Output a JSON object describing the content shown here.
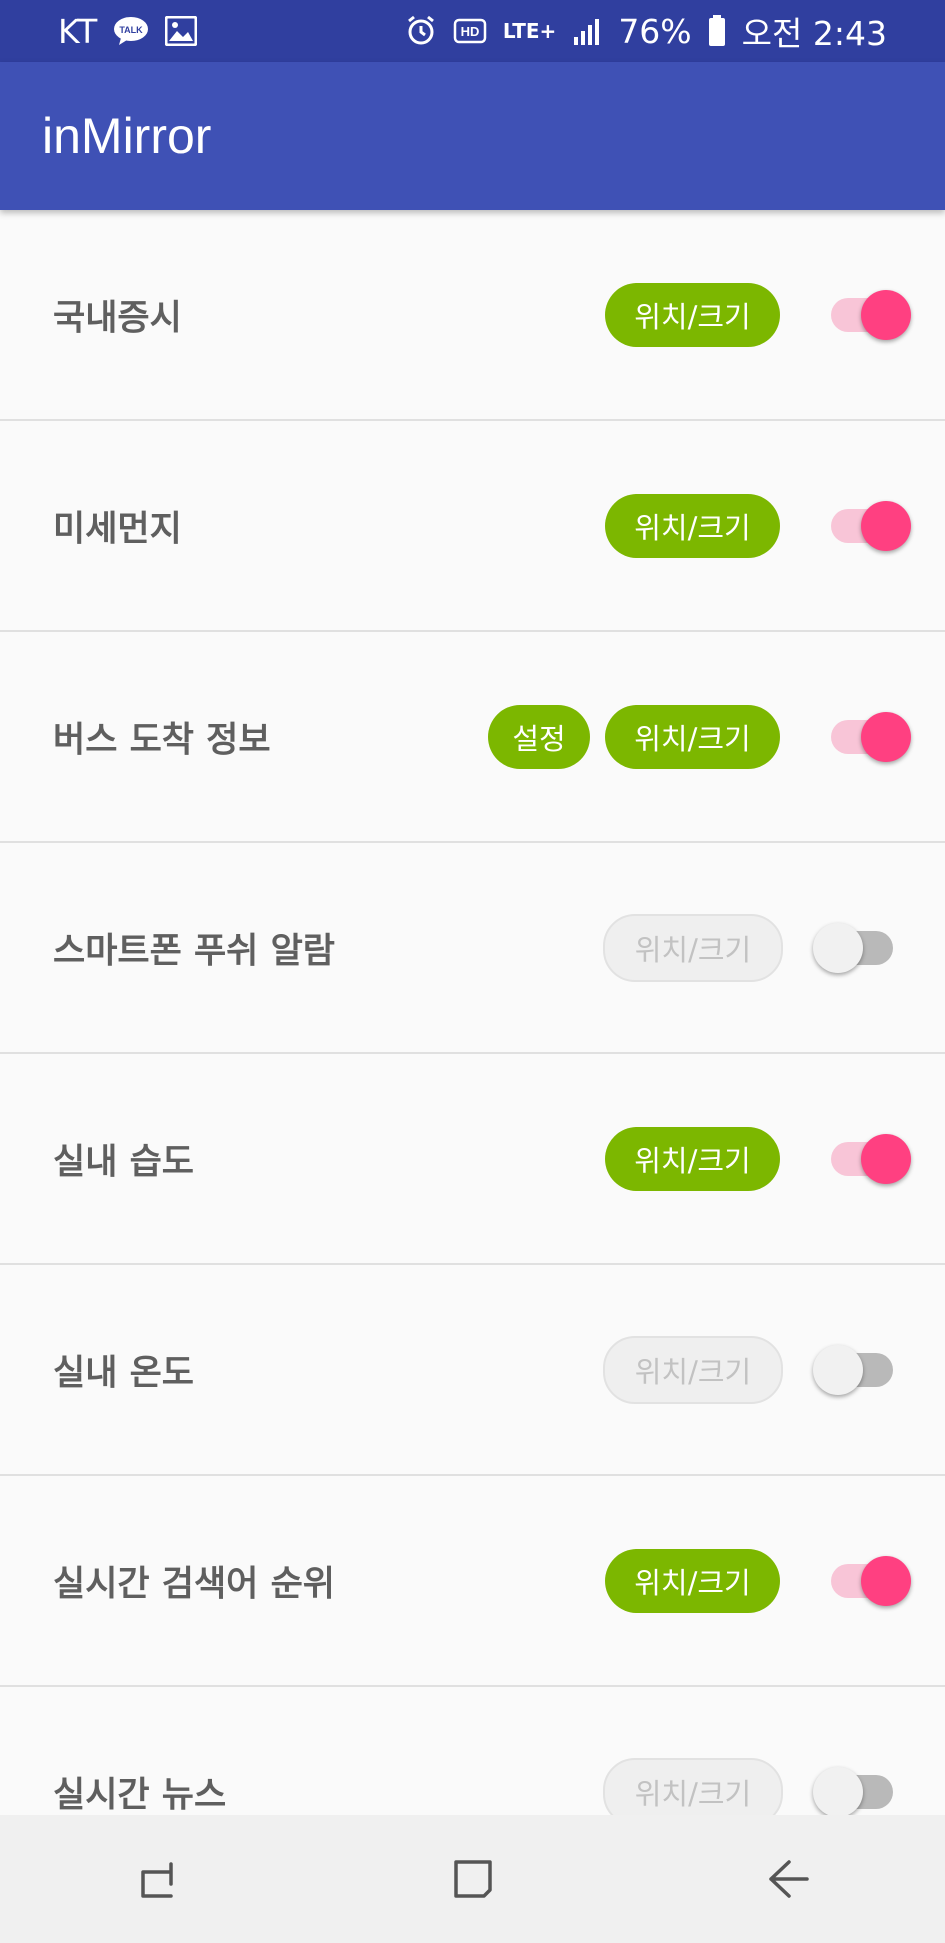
{
  "status_bar": {
    "carrier": "KT",
    "icons_left": [
      "talk-icon",
      "image-icon"
    ],
    "icons_right": [
      "alarm-icon",
      "hd-icon",
      "lte-icon",
      "signal-icon",
      "battery-icon"
    ],
    "network": "LTE+",
    "battery": "76%",
    "time": "오전 2:43"
  },
  "app_bar": {
    "title": "inMirror"
  },
  "colors": {
    "primary": "#3f51b5",
    "primary_dark": "#303f9f",
    "accent": "#ff4081",
    "button_green": "#7cb700"
  },
  "rows": [
    {
      "label": "국내증시",
      "size_button": "위치/크기",
      "enabled": true
    },
    {
      "label": "미세먼지",
      "size_button": "위치/크기",
      "enabled": true
    },
    {
      "label": "버스 도착 정보",
      "settings_button": "설정",
      "size_button": "위치/크기",
      "enabled": true
    },
    {
      "label": "스마트폰 푸쉬 알람",
      "size_button": "위치/크기",
      "enabled": false
    },
    {
      "label": "실내 습도",
      "size_button": "위치/크기",
      "enabled": true
    },
    {
      "label": "실내 온도",
      "size_button": "위치/크기",
      "enabled": false
    },
    {
      "label": "실시간 검색어 순위",
      "size_button": "위치/크기",
      "enabled": true
    },
    {
      "label": "실시간 뉴스",
      "size_button": "위치/크기",
      "enabled": false
    }
  ],
  "nav_bar": {
    "icons": [
      "recent-apps-icon",
      "home-icon",
      "back-icon"
    ]
  }
}
